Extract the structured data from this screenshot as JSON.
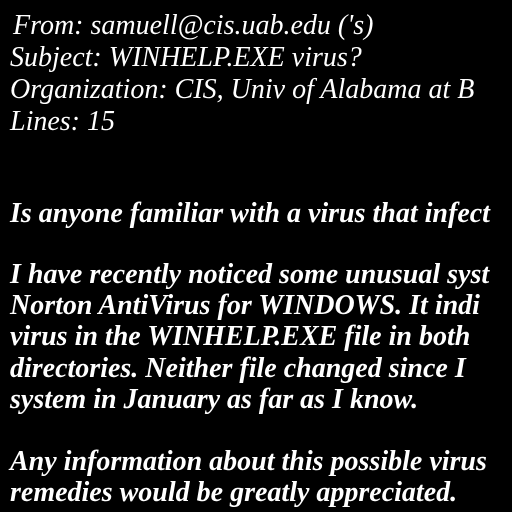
{
  "email": {
    "headers": {
      "from": "From: samuell@cis.uab.edu ('s)",
      "subject": "Subject: WINHELP.EXE virus?",
      "organization": "Organization: CIS, Univ of Alabama at B",
      "lines": "Lines: 15"
    },
    "body": {
      "question": "Is anyone familiar with a virus that infect",
      "paragraph_lines": [
        "I have recently noticed some unusual syst",
        "Norton AntiVirus for WINDOWS.  It indi",
        "virus in the WINHELP.EXE file in both",
        "directories.  Neither file changed since I",
        "system in January as far as I know."
      ],
      "closing_lines": [
        "Any information about this possible virus",
        "remedies would be greatly appreciated."
      ]
    }
  },
  "colors": {
    "background": "#000000",
    "text": "#ffffff"
  }
}
